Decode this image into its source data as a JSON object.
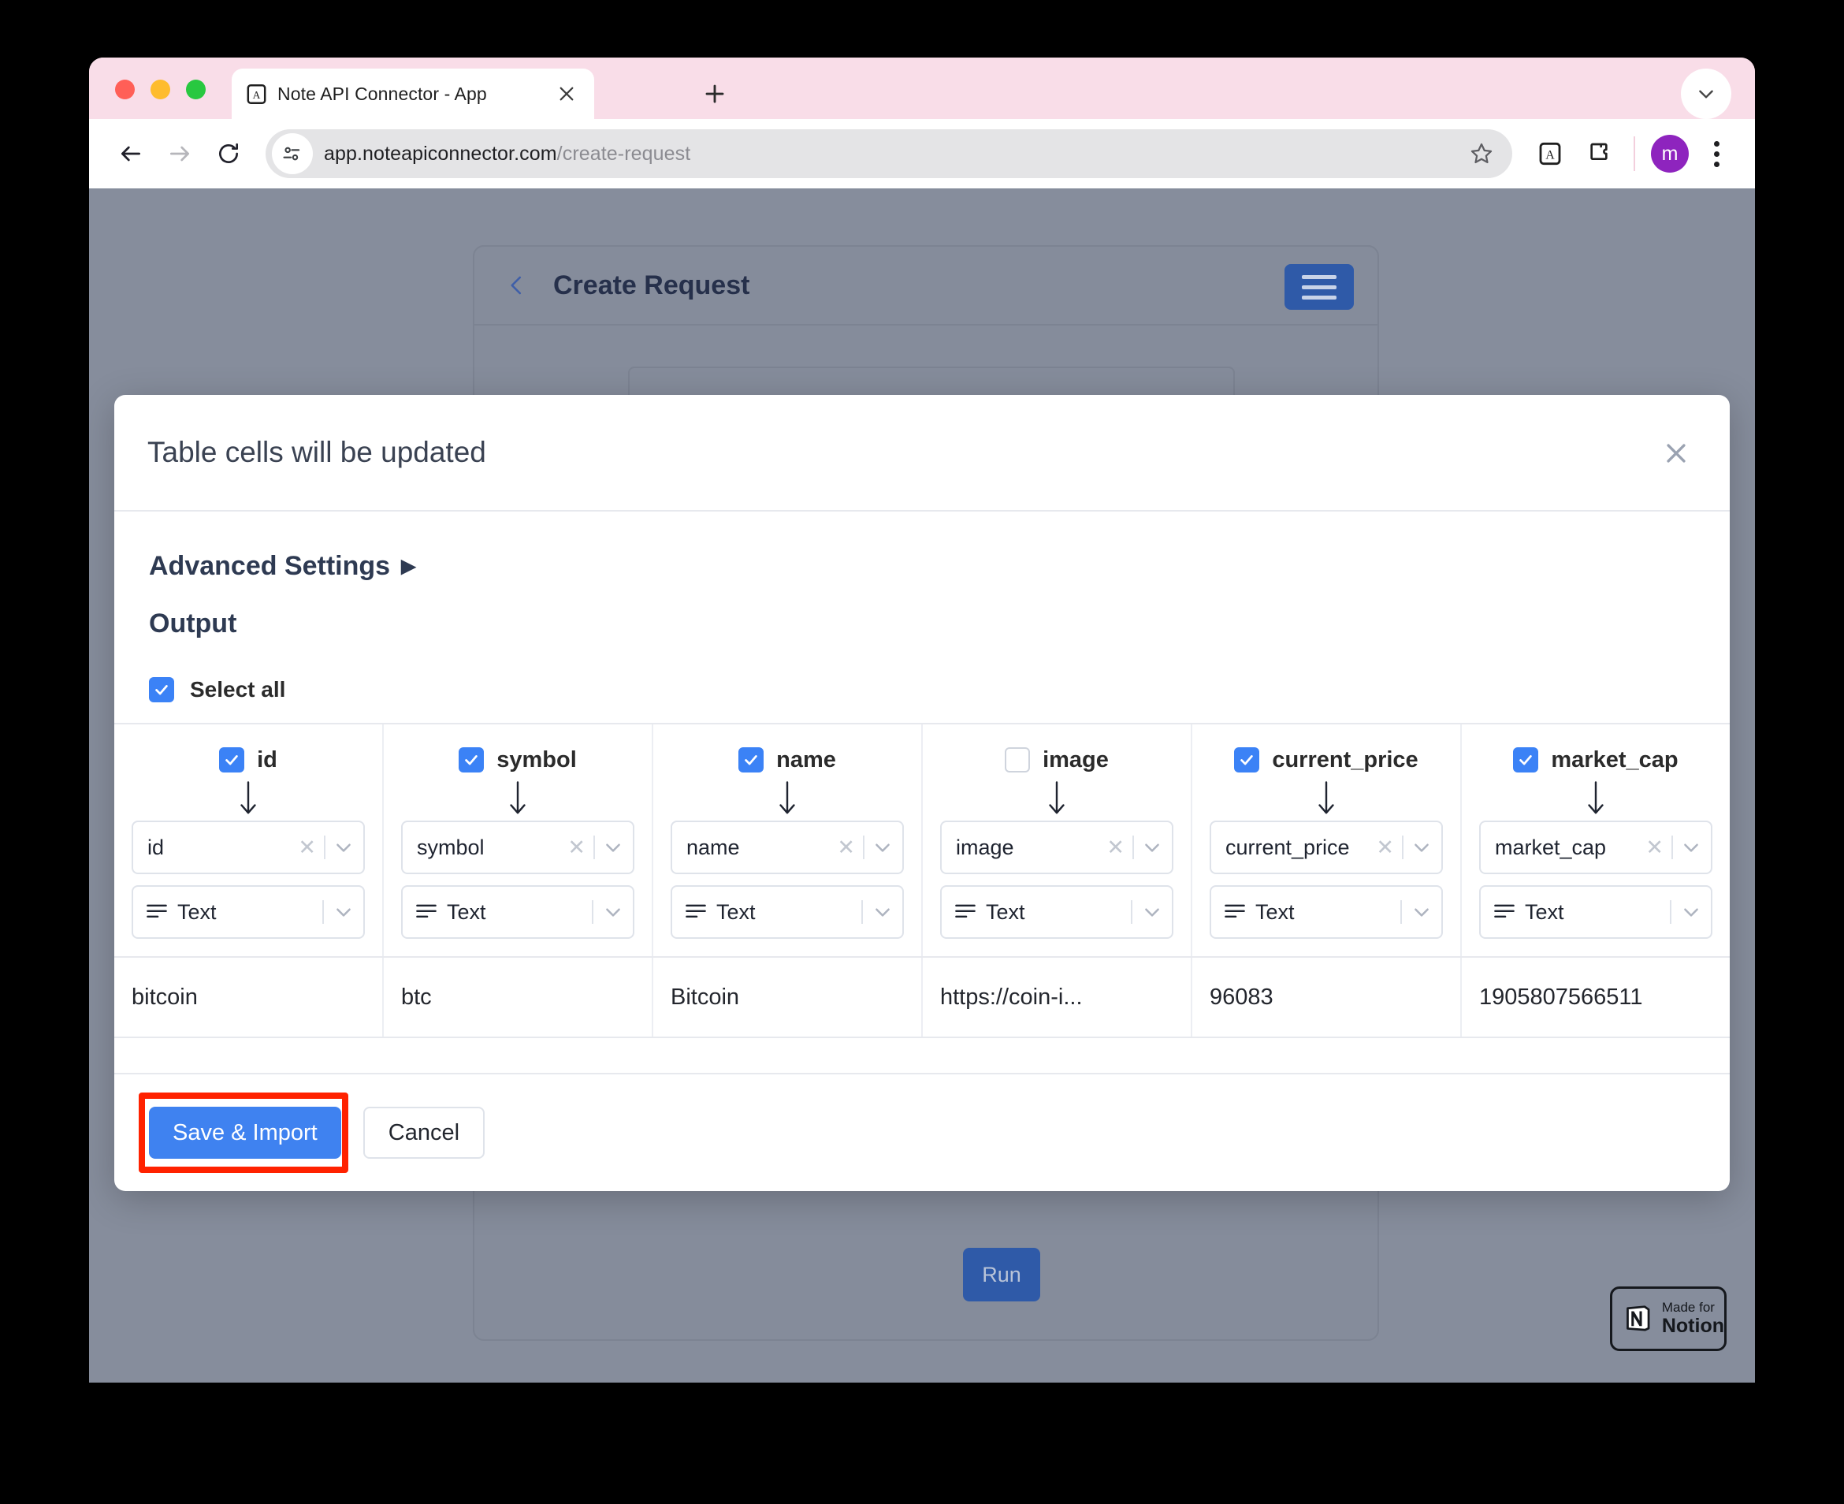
{
  "browser": {
    "tab": {
      "title": "Note API Connector - App",
      "favicon": "notion-app-icon",
      "close_icon": "close-icon"
    },
    "new_tab_icon": "plus-icon",
    "tabstrip_chevron_icon": "chevron-down-icon",
    "toolbar": {
      "back_icon": "back-arrow-icon",
      "forward_icon": "forward-arrow-icon",
      "reload_icon": "reload-icon",
      "site_info_icon": "page-info-icon",
      "url_host": "app.noteapiconnector.com",
      "url_path": "/create-request",
      "bookmark_icon": "star-icon",
      "extension_app_icon": "notion-app-icon",
      "extensions_icon": "puzzle-piece-icon",
      "profile_initial": "m",
      "menu_icon": "three-dots-menu-icon"
    }
  },
  "app": {
    "back_icon": "chevron-left-icon",
    "title": "Create Request",
    "menu_icon": "hamburger-menu-icon",
    "run_label": "Run",
    "notion_badge": {
      "made_for": "Made for",
      "notion": "Notion",
      "icon": "notion-logo-icon"
    }
  },
  "modal": {
    "title": "Table cells will be updated",
    "close_icon": "close-icon",
    "advanced_settings_label": "Advanced Settings",
    "advanced_settings_caret": "▶",
    "output_heading": "Output",
    "select_all": {
      "label": "Select all",
      "checked": true
    },
    "columns": [
      {
        "name": "id",
        "checked": true,
        "mapping": "id",
        "type": "Text"
      },
      {
        "name": "symbol",
        "checked": true,
        "mapping": "symbol",
        "type": "Text"
      },
      {
        "name": "name",
        "checked": true,
        "mapping": "name",
        "type": "Text"
      },
      {
        "name": "image",
        "checked": false,
        "mapping": "image",
        "type": "Text"
      },
      {
        "name": "current_price",
        "checked": true,
        "mapping": "current_price",
        "type": "Text"
      },
      {
        "name": "market_cap",
        "checked": true,
        "mapping": "market_cap",
        "type": "Text"
      }
    ],
    "rows": [
      [
        "bitcoin",
        "btc",
        "Bitcoin",
        "https://coin-i...",
        "96083",
        "1905807566511"
      ]
    ],
    "footer": {
      "save_label": "Save & Import",
      "cancel_label": "Cancel"
    },
    "clear_icon": "x-clear-icon",
    "caret_icon": "chevron-down-icon",
    "type_icon": "text-lines-icon",
    "arrow_icon": "down-arrow-icon"
  },
  "colors": {
    "accent_blue": "#3f82f0",
    "checkbox_blue": "#3b82f6",
    "highlight_red": "#ff2200",
    "profile_purple": "#8e24be",
    "tab_pink": "#f9dde8"
  }
}
